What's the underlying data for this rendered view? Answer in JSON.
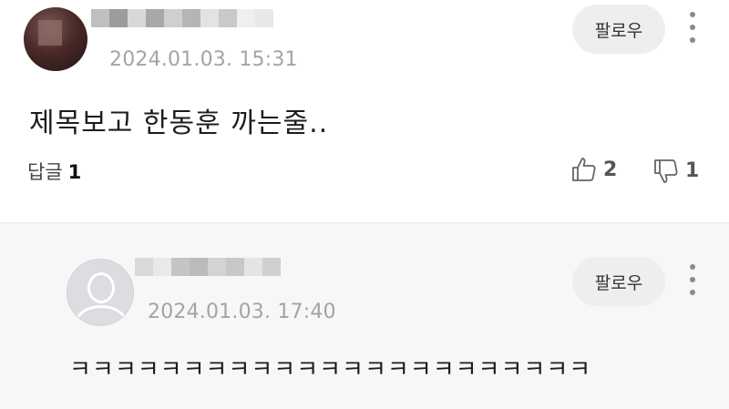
{
  "comment": {
    "date": "2024.01.03. 15:31",
    "follow_label": "팔로우",
    "text": "제목보고 한동훈 까는줄..",
    "reply_label": "답글",
    "reply_count": "1",
    "like_count": "2",
    "dislike_count": "1"
  },
  "reply": {
    "date": "2024.01.03. 17:40",
    "follow_label": "팔로우",
    "text": "ㅋㅋㅋㅋㅋㅋㅋㅋㅋㅋㅋㅋㅋㅋㅋㅋㅋㅋㅋㅋㅋㅋㅋ"
  },
  "icons": {
    "more": "more-vertical-icon",
    "like": "thumbs-up-icon",
    "dislike": "thumbs-down-icon",
    "avatar_default": "user-silhouette-icon"
  }
}
